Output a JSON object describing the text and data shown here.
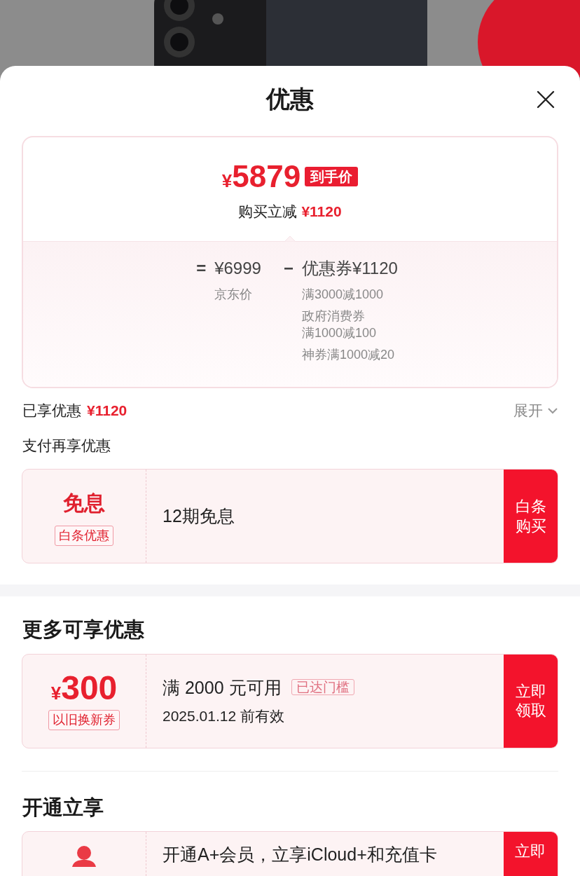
{
  "sheet": {
    "title": "优惠"
  },
  "price_card": {
    "symbol": "¥",
    "price": "5879",
    "price_tag": "到手价",
    "saving_label": "购买立减",
    "saving_amount": "¥1120",
    "breakdown": {
      "equals": "=",
      "base_price": "¥6999",
      "base_label": "京东价",
      "minus": "−",
      "coupon_total": "优惠券¥1120",
      "coupon_lines": [
        {
          "lines": [
            "满3000减1000"
          ]
        },
        {
          "lines": [
            "政府消费券",
            "满1000减100"
          ]
        },
        {
          "lines": [
            "神券满1000减20"
          ]
        }
      ]
    }
  },
  "enjoyed": {
    "label": "已享优惠",
    "amount": "¥1120",
    "toggle": "展开",
    "expanded": false
  },
  "sections": [
    {
      "title": "支付再享优惠",
      "offers": [
        {
          "kind": "installment",
          "headline": "免息",
          "tag": "白条优惠",
          "description": "12期免息",
          "action": "白条购买"
        }
      ]
    },
    {
      "title": "更多可享优惠",
      "offers": [
        {
          "kind": "coupon",
          "symbol": "¥",
          "amount": "300",
          "tag": "以旧换新券",
          "condition": "满 2000 元可用",
          "badge": "已达门槛",
          "validity": "2025.01.12 前有效",
          "action": "立即领取"
        }
      ]
    },
    {
      "title": "开通立享",
      "offers": [
        {
          "kind": "membership",
          "description": "开通A+会员，立享iCloud+和充值卡",
          "action": "立即"
        }
      ]
    }
  ]
}
